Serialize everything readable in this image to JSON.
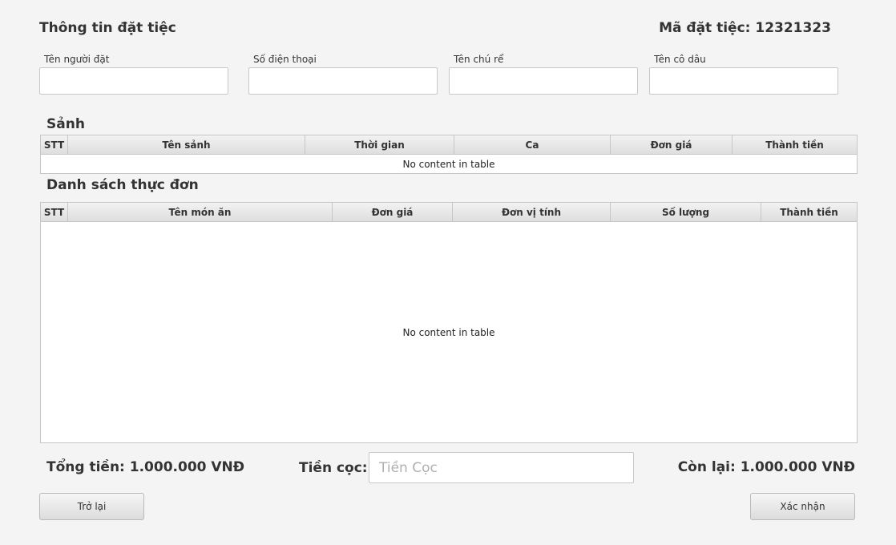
{
  "header": {
    "title": "Thông tin đặt tiệc",
    "booking_code": "Mã đặt tiệc: 12321323"
  },
  "form": {
    "fields": [
      {
        "label": "Tên người đặt",
        "value": ""
      },
      {
        "label": "Số điện thoại",
        "value": ""
      },
      {
        "label": "Tên chú rể",
        "value": ""
      },
      {
        "label": "Tên cô dâu",
        "value": ""
      }
    ]
  },
  "hall_section": {
    "title": "Sảnh",
    "columns": [
      "STT",
      "Tên sảnh",
      "Thời gian",
      "Ca",
      "Đơn giá",
      "Thành tiền"
    ],
    "rows": [],
    "empty_message": "No content in table"
  },
  "menu_section": {
    "title": "Danh sách thực đơn",
    "columns": [
      "STT",
      "Tên món ăn",
      "Đơn giá",
      "Đơn vị tính",
      "Số lượng",
      "Thành tiền"
    ],
    "rows": [],
    "empty_message": "No content in table"
  },
  "summary": {
    "total": "Tổng tiền: 1.000.000 VNĐ",
    "deposit_label": "Tiền cọc:",
    "deposit_placeholder": "Tiền Cọc",
    "deposit_value": "",
    "remaining": "Còn lại: 1.000.000 VNĐ"
  },
  "actions": {
    "back_label": "Trở lại",
    "confirm_label": "Xác nhận"
  }
}
